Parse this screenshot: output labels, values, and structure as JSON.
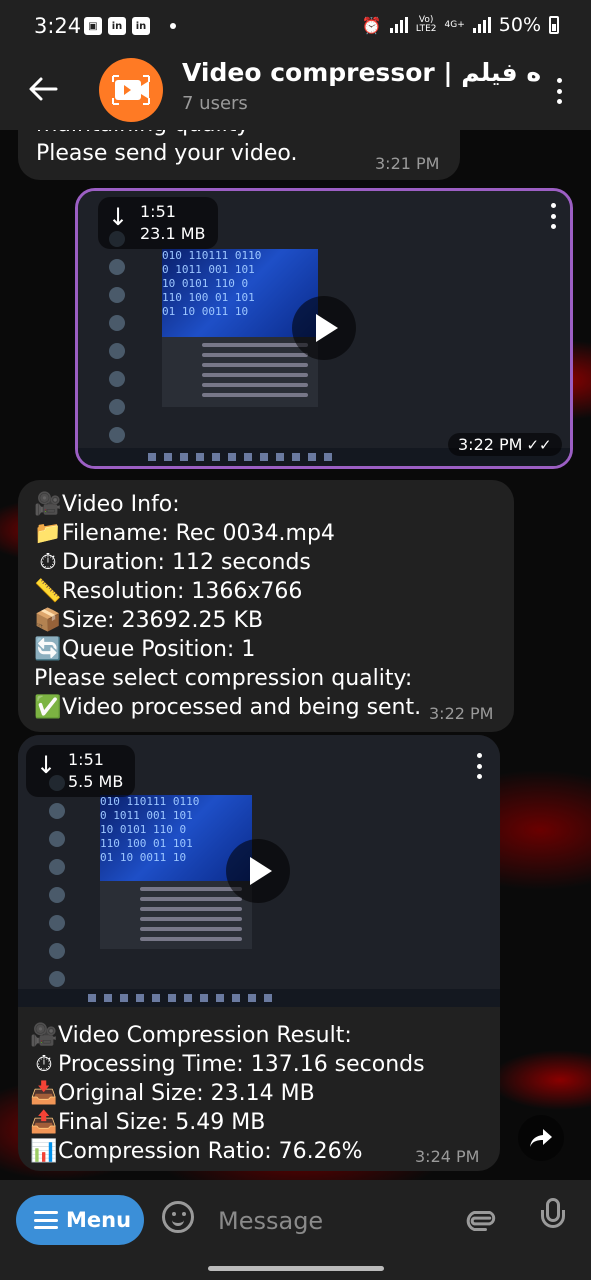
{
  "status_bar": {
    "time": "3:24",
    "network_top": "Vo)",
    "network_bottom": "LTE2",
    "network_type": "4G+",
    "battery": "50%"
  },
  "header": {
    "title": "Video compressor | فشرده فیلم",
    "subtitle": "7 users",
    "avatar_color": "#ff7a24"
  },
  "messages": {
    "m1": {
      "line1": "maintaining quality",
      "line2": "Please send your video.",
      "time": "3:21 PM"
    },
    "m2": {
      "duration": "1:51",
      "size": "23.1 MB",
      "time": "3:22 PM",
      "border_color": "#9c5fc4"
    },
    "m3": {
      "lines": [
        {
          "emoji": "🎥",
          "text": "Video Info:"
        },
        {
          "emoji": "📁",
          "text": "Filename: Rec 0034.mp4"
        },
        {
          "emoji": "⏱",
          "text": "Duration: 112 seconds"
        },
        {
          "emoji": "📏",
          "text": "Resolution: 1366x766"
        },
        {
          "emoji": "📦",
          "text": "Size: 23692.25 KB"
        },
        {
          "emoji": "🔄",
          "text": "Queue Position: 1"
        },
        {
          "emoji": "",
          "text": "Please select compression quality:"
        },
        {
          "emoji": "✅",
          "text": "Video processed and being sent."
        }
      ],
      "time": "3:22 PM"
    },
    "m4": {
      "duration": "1:51",
      "size": "5.5 MB",
      "lines": [
        {
          "emoji": "🎥",
          "text": "Video Compression Result:"
        },
        {
          "emoji": "⏱",
          "text": "Processing Time: 137.16 seconds"
        },
        {
          "emoji": "📥",
          "text": "Original Size: 23.14 MB"
        },
        {
          "emoji": "📤",
          "text": "Final Size: 5.49 MB"
        },
        {
          "emoji": "📊",
          "text": "Compression Ratio: 76.26%"
        }
      ],
      "time": "3:24 PM"
    }
  },
  "input_bar": {
    "menu_label": "Menu",
    "placeholder": "Message",
    "accent": "#3b8fd8"
  }
}
